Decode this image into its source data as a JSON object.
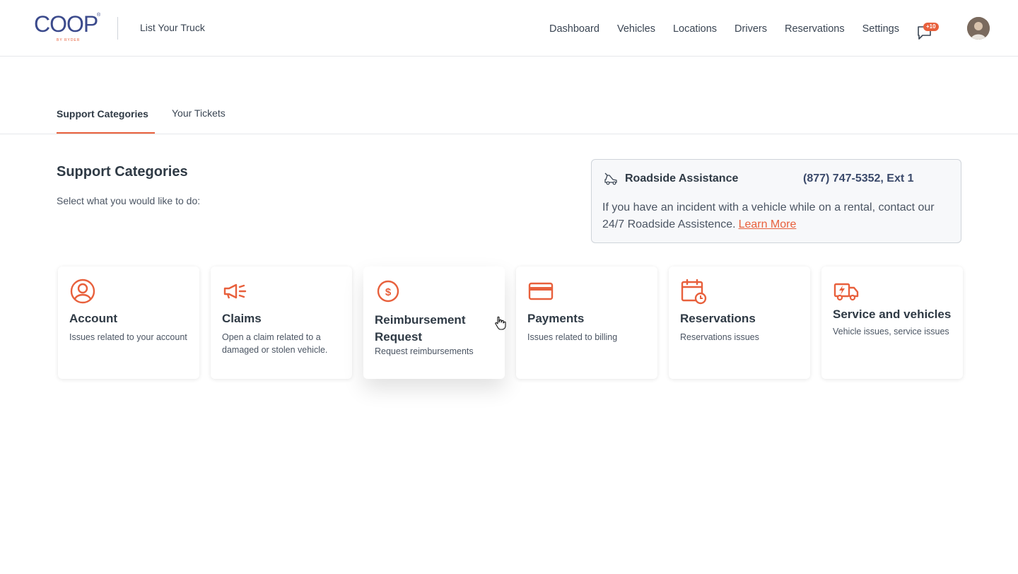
{
  "brand": {
    "logo_text": "COOP",
    "logo_registered": "®",
    "logo_subtext": "BY RYDER",
    "list_truck": "List Your Truck"
  },
  "nav": {
    "items": [
      "Dashboard",
      "Vehicles",
      "Locations",
      "Drivers",
      "Reservations",
      "Settings"
    ],
    "messages_badge": "+10"
  },
  "tabs": [
    {
      "label": "Support Categories",
      "active": true
    },
    {
      "label": "Your Tickets",
      "active": false
    }
  ],
  "section": {
    "title": "Support Categories",
    "subtitle": "Select what you would like to do:"
  },
  "roadside": {
    "title": "Roadside Assistance",
    "phone": "(877) 747-5352, Ext 1",
    "body": "If you have an incident with a vehicle while on a rental, contact our 24/7 Roadside Assistence.",
    "link": "Learn More"
  },
  "cards": [
    {
      "title": "Account",
      "desc": "Issues related to your account",
      "icon": "user-circle-icon"
    },
    {
      "title": "Claims",
      "desc": "Open a claim related to a damaged or stolen vehicle.",
      "icon": "megaphone-icon"
    },
    {
      "title": "Reimbursement Request",
      "desc": "Request reimbursements",
      "icon": "dollar-circle-icon"
    },
    {
      "title": "Payments",
      "desc": "Issues related to billing",
      "icon": "credit-card-icon"
    },
    {
      "title": "Reservations",
      "desc": "Reservations issues",
      "icon": "calendar-clock-icon"
    },
    {
      "title": "Service and vehicles",
      "desc": "Vehicle issues, service issues",
      "icon": "truck-service-icon"
    }
  ],
  "colors": {
    "accent": "#e8603c",
    "brand": "#3b4a8c",
    "text": "#2f3a45"
  }
}
